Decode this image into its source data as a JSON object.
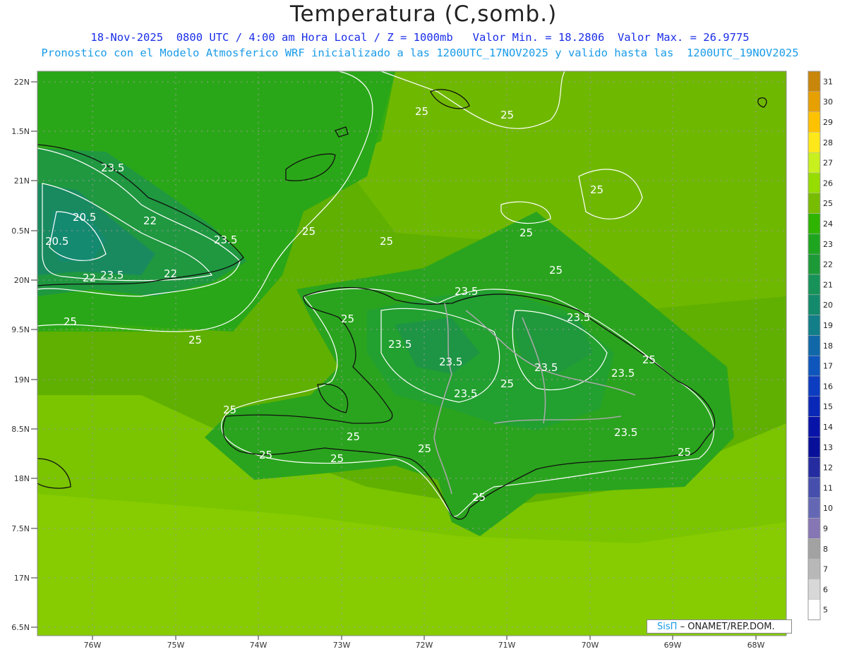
{
  "title": "Temperatura (C,somb.)",
  "subtitle1": "18-Nov-2025  0800 UTC / 4:00 am Hora Local / Z = 1000mb   Valor Min. = 18.2806  Valor Max. = 26.9775",
  "subtitle2": "Pronostico con el Modelo Atmosferico WRF inicializado a las 1200UTC_17NOV2025 y valido hasta las  1200UTC_19NOV2025",
  "credit": {
    "brand": "SisΠ",
    "text": "– ONAMET/REP.DOM."
  },
  "map": {
    "lat_labels": [
      "22N",
      "1.5N",
      "21N",
      "0.5N",
      "20N",
      "9.5N",
      "19N",
      "8.5N",
      "18N",
      "7.5N",
      "17N",
      "6.5N"
    ],
    "lon_labels": [
      "76W",
      "75W",
      "74W",
      "73W",
      "72W",
      "71W",
      "70W",
      "69W",
      "68W"
    ],
    "contour_labels": [
      "23.5",
      "20.5",
      "20.5",
      "22",
      "23.5",
      "22",
      "23.5",
      "22",
      "25",
      "25",
      "25",
      "25",
      "25",
      "25",
      "25",
      "25",
      "23.5",
      "25",
      "23.5",
      "23.5",
      "23.5",
      "25",
      "23.5",
      "25",
      "23.5",
      "25",
      "23.5",
      "23.5",
      "25",
      "25",
      "25",
      "25",
      "25",
      "25",
      "25"
    ]
  },
  "colorbar": {
    "levels": [
      "31",
      "30",
      "29",
      "28",
      "27",
      "26",
      "25",
      "24",
      "23",
      "22",
      "21",
      "20",
      "19",
      "18",
      "17",
      "16",
      "15",
      "14",
      "13",
      "12",
      "11",
      "10",
      "9",
      "8",
      "7",
      "6",
      "5"
    ],
    "colors": [
      "#c8860a",
      "#e6a000",
      "#ffc200",
      "#ffe81a",
      "#c8f01e",
      "#96dc00",
      "#78bc00",
      "#2fb400",
      "#1ea520",
      "#1c9a38",
      "#179258",
      "#148a6c",
      "#127e88",
      "#1068a8",
      "#0f56bc",
      "#0c3cc0",
      "#0a28b8",
      "#0814a8",
      "#08109a",
      "#242ca0",
      "#4650ac",
      "#6468b4",
      "#8676b4",
      "#a2a2a2",
      "#b8b8b8",
      "#d8d8d8",
      "#ffffff"
    ]
  }
}
